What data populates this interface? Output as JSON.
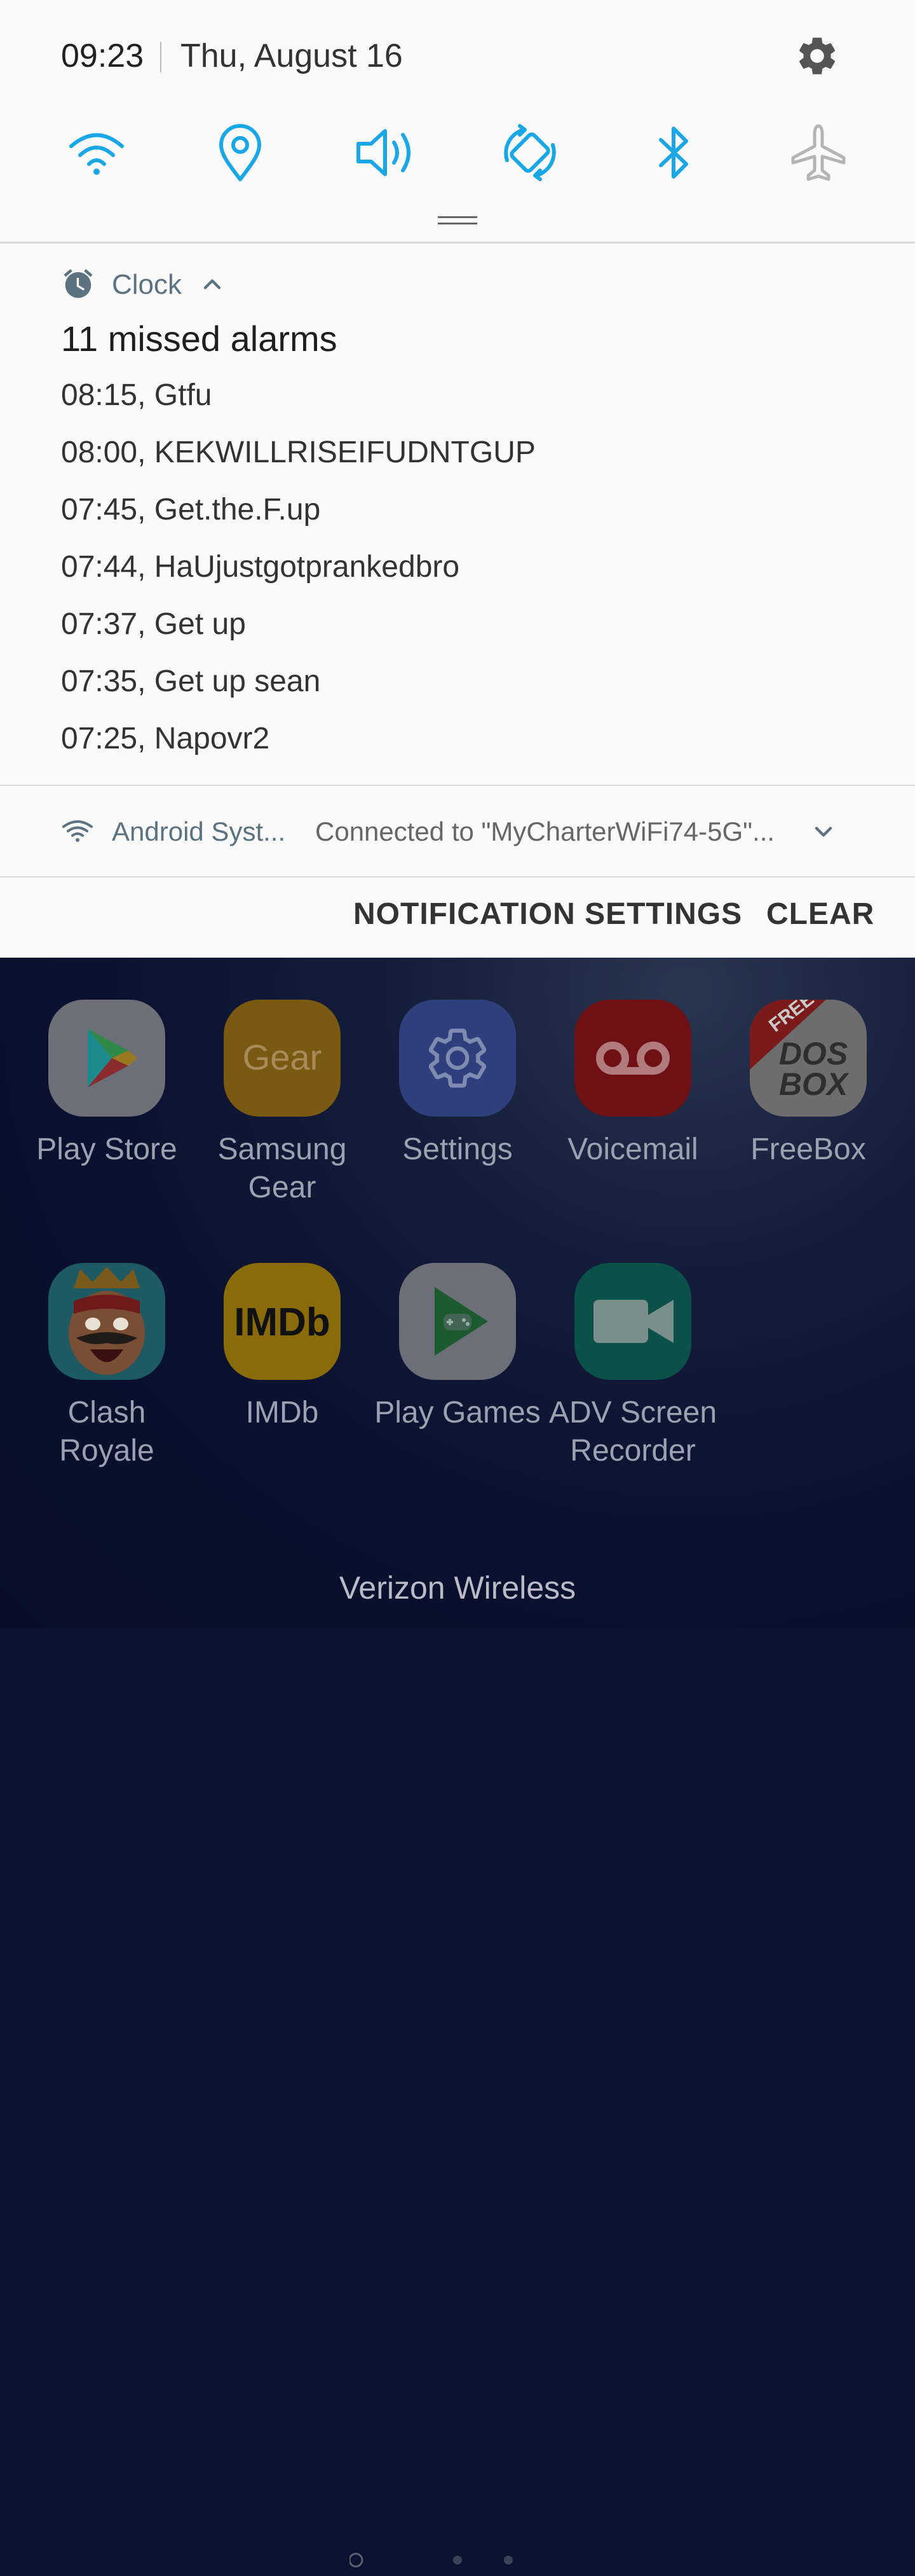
{
  "status_bar": {
    "time": "09:23",
    "date": "Thu, August 16",
    "settings_icon": "gear-icon"
  },
  "quick_toggles": [
    {
      "name": "wifi",
      "icon": "wifi-icon",
      "active": true
    },
    {
      "name": "location",
      "icon": "location-pin-icon",
      "active": true
    },
    {
      "name": "sound",
      "icon": "speaker-icon",
      "active": true
    },
    {
      "name": "auto-rotate",
      "icon": "rotate-icon",
      "active": true
    },
    {
      "name": "bluetooth",
      "icon": "bluetooth-icon",
      "active": true
    },
    {
      "name": "airplane-mode",
      "icon": "airplane-icon",
      "active": false
    }
  ],
  "colors": {
    "toggle_active": "#1aa7e8",
    "toggle_inactive": "#b5b5b5",
    "notification_app_name": "#5b7280"
  },
  "clock_notification": {
    "app_name": "Clock",
    "title": "11 missed alarms",
    "alarms": [
      "08:15, Gtfu",
      "08:00, KEKWILLRISEIFUDNTGUP",
      "07:45, Get.the.F.up",
      "07:44, HaUjustgotprankedbro",
      "07:37, Get up",
      "07:35, Get up sean",
      "07:25, Napovr2"
    ]
  },
  "android_notification": {
    "app_name": "Android Syst...",
    "text": "Connected to \"MyCharterWiFi74-5G\"..."
  },
  "actions": {
    "notification_settings": "NOTIFICATION SETTINGS",
    "clear": "CLEAR"
  },
  "apps": [
    {
      "label": "Play Store",
      "icon": "play-store-icon"
    },
    {
      "label": "Samsung Gear",
      "icon": "samsung-gear-icon",
      "icon_text": "Gear"
    },
    {
      "label": "Settings",
      "icon": "settings-gear-icon"
    },
    {
      "label": "Voicemail",
      "icon": "voicemail-icon"
    },
    {
      "label": "FreeBox",
      "icon": "freebox-icon",
      "icon_text_1": "FREE",
      "icon_text_2": "DOS",
      "icon_text_3": "BOX"
    },
    {
      "label": "Clash Royale",
      "icon": "clash-royale-icon"
    },
    {
      "label": "IMDb",
      "icon": "imdb-icon",
      "icon_text": "IMDb"
    },
    {
      "label": "Play Games",
      "icon": "play-games-icon"
    },
    {
      "label": "ADV Screen Recorder",
      "icon": "video-camera-icon"
    }
  ],
  "carrier": "Verizon Wireless"
}
